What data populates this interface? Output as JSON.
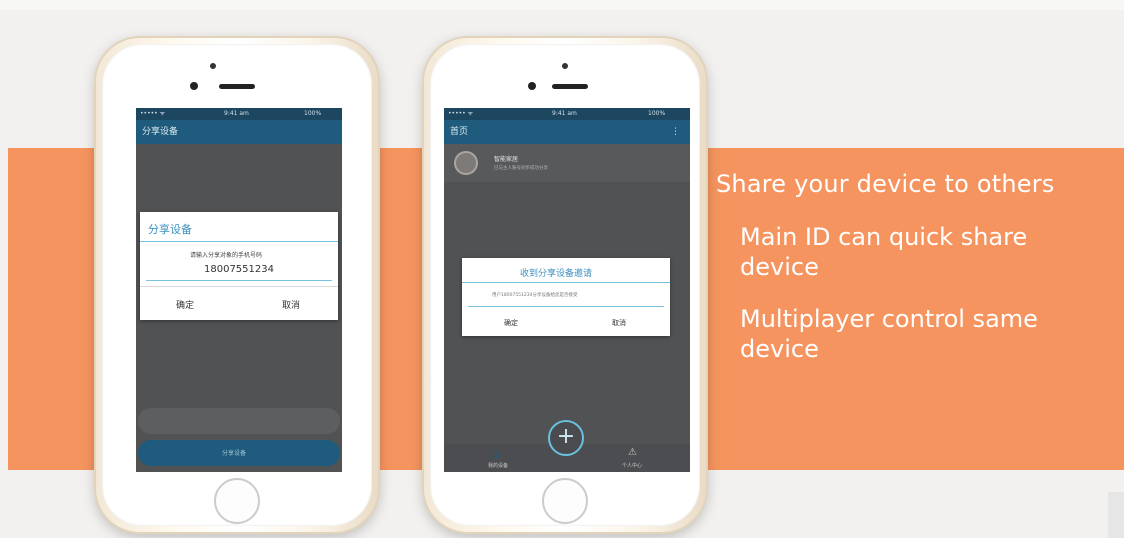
{
  "marketing": {
    "headline": "Share your device to others",
    "points": [
      "Main ID can quick share device",
      "Multiplayer control same device"
    ]
  },
  "phone_left": {
    "status": {
      "carrier": "•••••  ᯤ",
      "time": "9:41 am",
      "battery": "100%"
    },
    "appbar_title": "分享设备",
    "dialog": {
      "title": "分享设备",
      "hint": "请输入分享对象的手机号码",
      "phone_value": "18007551234",
      "confirm": "确定",
      "cancel": "取消"
    },
    "share_button": "分享设备"
  },
  "phone_right": {
    "status": {
      "carrier": "•••••  ᯤ",
      "time": "9:41 am",
      "battery": "100%"
    },
    "appbar_title": "首页",
    "device": {
      "name": "智能家居",
      "subtitle": "已与主人账号同步成功分享"
    },
    "dialog": {
      "title": "收到分享设备邀请",
      "message": "用户18007551234分享设备给您是否接受",
      "confirm": "确定",
      "cancel": "取消"
    },
    "tabs": {
      "home": "我的设备",
      "add": "+",
      "profile": "个人中心"
    }
  },
  "colors": {
    "band": "#f6945f",
    "appbar": "#1e5b7c",
    "accent": "#3d8fbf"
  }
}
